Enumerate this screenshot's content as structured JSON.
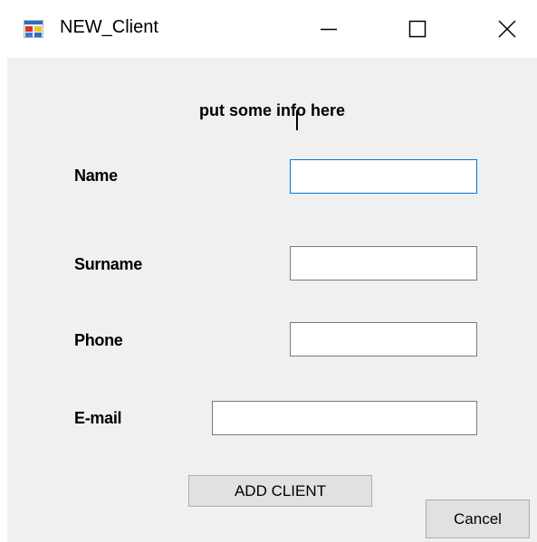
{
  "window": {
    "title": "NEW_Client",
    "icons": {
      "app": "form-window-icon",
      "minimize": "minimize-icon",
      "maximize": "maximize-icon",
      "close": "close-icon"
    }
  },
  "form": {
    "heading": "put some info here",
    "fields": {
      "name": {
        "label": "Name",
        "value": ""
      },
      "surname": {
        "label": "Surname",
        "value": ""
      },
      "phone": {
        "label": "Phone",
        "value": ""
      },
      "email": {
        "label": "E-mail",
        "value": ""
      }
    },
    "add_button_label": "ADD CLIENT",
    "cancel_button_label": "Cancel"
  },
  "colors": {
    "client_background": "#f0f0f0",
    "focus_border": "#0078d7",
    "button_face": "#e1e1e1"
  }
}
